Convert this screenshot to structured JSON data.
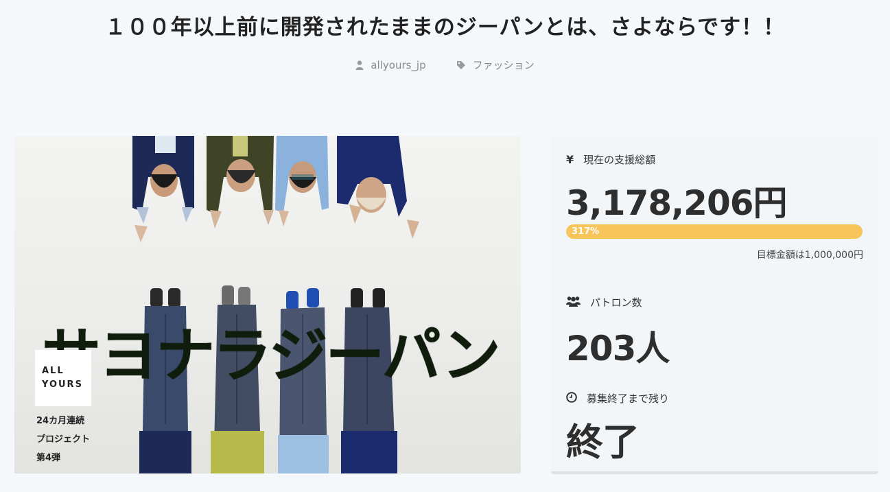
{
  "page": {
    "title": "１００年以上前に開発されたままのジーパンとは、さよならです！！",
    "author": "allyours_jp",
    "category": "ファッション"
  },
  "hero": {
    "headline": "サヨナラジーパン",
    "logo_line1": "ALL",
    "logo_line2": "YOURS",
    "series_line1": "24カ月連続",
    "series_line2": "プロジェクト",
    "series_line3": "第4弾"
  },
  "stats": {
    "funding_label": "現在の支援総額",
    "funding_amount": "3,178,206円",
    "progress_text": "317%",
    "progress_fraction": 1.0,
    "goal_text": "目標金額は1,000,000円",
    "patrons_label": "パトロン数",
    "patrons_count": "203人",
    "remaining_label": "募集終了まで残り",
    "remaining_value": "終了"
  },
  "icons": {
    "author": "user-icon",
    "category": "tag-icon",
    "funding": "yen-icon",
    "patrons": "users-icon",
    "remaining": "clock-icon"
  },
  "colors": {
    "progress": "#f7c55a",
    "background": "#f5f8fb"
  }
}
